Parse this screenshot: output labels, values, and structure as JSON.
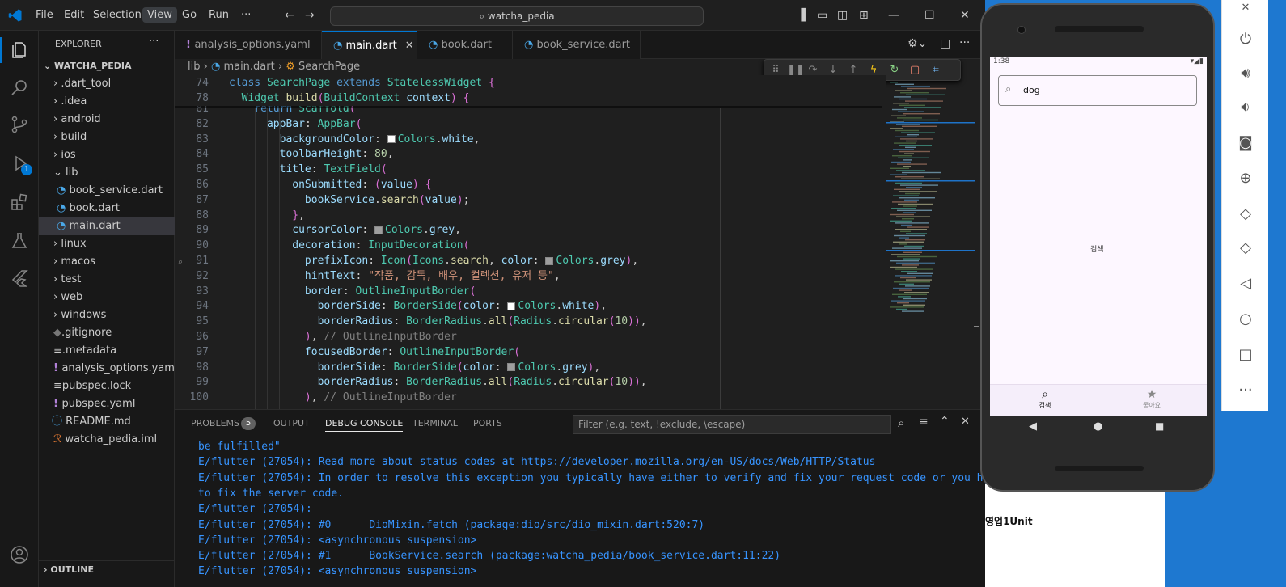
{
  "menu": [
    "File",
    "Edit",
    "Selection",
    "View",
    "Go",
    "Run",
    "···"
  ],
  "command_center": "watcha_pedia",
  "explorer": {
    "title": "EXPLORER",
    "project": "WATCHA_PEDIA",
    "items": [
      ".dart_tool",
      ".idea",
      "android",
      "build",
      "ios",
      "lib",
      "book_service.dart",
      "book.dart",
      "main.dart",
      "linux",
      "macos",
      "test",
      "web",
      "windows",
      ".gitignore",
      ".metadata",
      "analysis_options.yaml",
      "pubspec.lock",
      "pubspec.yaml",
      "README.md",
      "watcha_pedia.iml"
    ],
    "outline": "OUTLINE"
  },
  "debug_badge": "1",
  "tabs": [
    "analysis_options.yaml",
    "main.dart",
    "book.dart",
    "book_service.dart"
  ],
  "breadcrumb": {
    "a": "lib",
    "b": "main.dart",
    "c": "SearchPage"
  },
  "sticky": [
    {
      "ln": "74",
      "t": "class SearchPage extends StatelessWidget {"
    },
    {
      "ln": "78",
      "t": "  Widget build(BuildContext context) {"
    }
  ],
  "code": [
    {
      "ln": "81",
      "t": "    return Scaffold("
    },
    {
      "ln": "82",
      "t": "      appBar: AppBar("
    },
    {
      "ln": "83",
      "t": "        backgroundColor: Colors.white,"
    },
    {
      "ln": "84",
      "t": "        toolbarHeight: 80,"
    },
    {
      "ln": "85",
      "t": "        title: TextField("
    },
    {
      "ln": "86",
      "t": "          onSubmitted: (value) {"
    },
    {
      "ln": "87",
      "t": "            bookService.search(value);"
    },
    {
      "ln": "88",
      "t": "          },"
    },
    {
      "ln": "89",
      "t": "          cursorColor: Colors.grey,"
    },
    {
      "ln": "90",
      "t": "          decoration: InputDecoration("
    },
    {
      "ln": "91",
      "t": "            prefixIcon: Icon(Icons.search, color: Colors.grey),"
    },
    {
      "ln": "92",
      "t": "            hintText: \"작품, 감독, 배우, 컬렉션, 유저 등\","
    },
    {
      "ln": "93",
      "t": "            border: OutlineInputBorder("
    },
    {
      "ln": "94",
      "t": "              borderSide: BorderSide(color: Colors.white),"
    },
    {
      "ln": "95",
      "t": "              borderRadius: BorderRadius.all(Radius.circular(10)),"
    },
    {
      "ln": "96",
      "t": "            ), // OutlineInputBorder"
    },
    {
      "ln": "97",
      "t": "            focusedBorder: OutlineInputBorder("
    },
    {
      "ln": "98",
      "t": "              borderSide: BorderSide(color: Colors.grey),"
    },
    {
      "ln": "99",
      "t": "              borderRadius: BorderRadius.all(Radius.circular(10)),"
    },
    {
      "ln": "100",
      "t": "            ), // OutlineInputBorder"
    }
  ],
  "panel": {
    "tabs": [
      "PROBLEMS",
      "OUTPUT",
      "DEBUG CONSOLE",
      "TERMINAL",
      "PORTS"
    ],
    "problems_count": "5",
    "filter_placeholder": "Filter (e.g. text, !exclude, \\escape)",
    "console": [
      "be fulfilled\"",
      "E/flutter (27054): Read more about status codes at https://developer.mozilla.org/en-US/docs/Web/HTTP/Status",
      "E/flutter (27054): In order to resolve this exception you typically have either to verify and fix your request code or you have",
      "to fix the server code.",
      "E/flutter (27054):",
      "E/flutter (27054): #0      DioMixin.fetch (package:dio/src/dio_mixin.dart:520:7)",
      "E/flutter (27054): <asynchronous suspension>",
      "E/flutter (27054): #1      BookService.search (package:watcha_pedia/book_service.dart:11:22)",
      "E/flutter (27054): <asynchronous suspension>"
    ]
  },
  "phone": {
    "time": "1:38",
    "search_value": "dog",
    "body_text": "검색",
    "nav": [
      "검색",
      "좋아요"
    ]
  },
  "background": {
    "unit_text": "영업1Unit"
  }
}
